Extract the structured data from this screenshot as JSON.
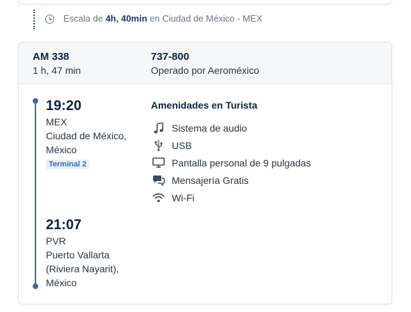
{
  "layover": {
    "prefix": "Escala de ",
    "duration": "4h, 40min",
    "suffix": " en Ciudad de México - MEX"
  },
  "segment": {
    "flight_number": "AM 338",
    "duration": "1 h, 47 min",
    "aircraft": "737-800",
    "operator": "Operado por Aeroméxico",
    "departure": {
      "time": "19:20",
      "code": "MEX",
      "city_line1": "Ciudad de México,",
      "city_line2": "México",
      "terminal": "Terminal 2"
    },
    "arrival": {
      "time": "21:07",
      "code": "PVR",
      "city_line1": "Puerto Vallarta",
      "city_line2": "(Riviera Nayarit),",
      "city_line3": "México"
    }
  },
  "amenities": {
    "title": "Amenidades en Turista",
    "items": [
      {
        "icon": "music-note-icon",
        "label": "Sistema de audio"
      },
      {
        "icon": "usb-icon",
        "label": "USB"
      },
      {
        "icon": "monitor-icon",
        "label": "Pantalla personal de 9 pulgadas"
      },
      {
        "icon": "chat-icon",
        "label": "Mensajería Gratis"
      },
      {
        "icon": "wifi-icon",
        "label": "Wi-Fi"
      }
    ]
  },
  "colors": {
    "accent": "#3c67a8",
    "text_dark": "#0b2343",
    "text_muted": "#6b7480"
  }
}
